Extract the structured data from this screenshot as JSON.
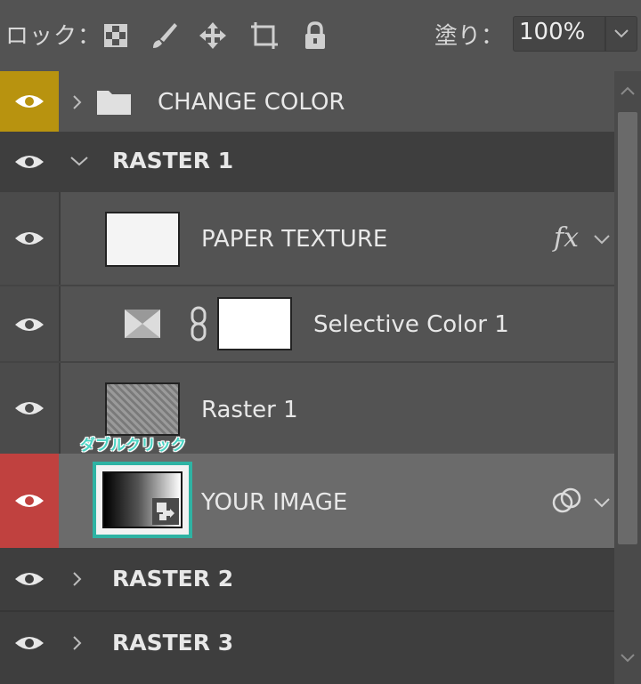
{
  "lockbar": {
    "lock_label": "ロック：",
    "icons": [
      "checker-lock-icon",
      "brush-lock-icon",
      "move-lock-icon",
      "artboard-lock-icon",
      "padlock-icon"
    ],
    "fill_label": "塗り：",
    "fill_value": "100%"
  },
  "layers": {
    "change_color": "CHANGE COLOR",
    "raster1_group": "RASTER 1",
    "paper_texture": "PAPER TEXTURE",
    "paper_fx": "fx",
    "selective_color": "Selective Color 1",
    "raster1_layer": "Raster 1",
    "your_image": "YOUR IMAGE",
    "raster2_group": "RASTER 2",
    "raster3_group": "RASTER 3"
  },
  "callout": "ダブルクリック",
  "colors": {
    "eye_yellow": "#b8930f",
    "eye_red": "#c0413f",
    "highlight_teal": "#2eb3a3"
  }
}
